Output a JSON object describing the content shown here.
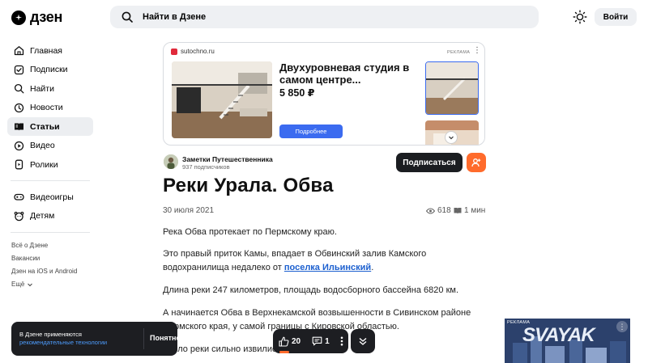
{
  "header": {
    "logo_text": "дзен",
    "search_placeholder": "Найти в Дзене",
    "login_label": "Войти"
  },
  "sidebar": {
    "items": [
      {
        "label": "Главная",
        "icon": "home-icon"
      },
      {
        "label": "Подписки",
        "icon": "subscriptions-icon"
      },
      {
        "label": "Найти",
        "icon": "search-icon"
      },
      {
        "label": "Новости",
        "icon": "news-icon"
      },
      {
        "label": "Статьи",
        "icon": "articles-icon",
        "active": true
      },
      {
        "label": "Видео",
        "icon": "video-icon"
      },
      {
        "label": "Ролики",
        "icon": "clips-icon"
      },
      {
        "label": "Видеоигры",
        "icon": "gamepad-icon"
      },
      {
        "label": "Детям",
        "icon": "kids-icon"
      }
    ],
    "footer_links": [
      "Всё о Дзене",
      "Вакансии",
      "Дзен на iOS и Android",
      "Ещё"
    ]
  },
  "ad": {
    "source": "sutochno.ru",
    "label": "РЕКЛАМА",
    "title": "Двухуровневая студия в самом центре...",
    "price": "5 850 ₽",
    "button": "Подробнее"
  },
  "channel": {
    "name": "Заметки Путешественника",
    "subscribers": "937 подписчиков",
    "subscribe_label": "Подписаться"
  },
  "article": {
    "title": "Реки Урала. Обва",
    "date": "30 июля 2021",
    "views": "618",
    "read_time": "1 мин",
    "p1": "Река Обва протекает по Пермскому краю.",
    "p2_before": "Это правый приток Камы, впадает в Обвинский залив Камского водохранилища недалеко от ",
    "p2_link": "поселка Ильинский",
    "p2_after": ".",
    "p3": "Длина реки 247 километров, площадь водосборного бассейна 6820 км.",
    "p4": "А начинается Обва в Верхнекамской возвышенности в Сивинском районе Пермского края, у самой границы с Кировской областью.",
    "p5": "Русло реки сильно извилистое"
  },
  "toast": {
    "line1": "В Дзене применяются",
    "link": "рекомендательные технологии",
    "button": "Понятно"
  },
  "actions": {
    "likes": "20",
    "comments": "1"
  },
  "side_ad": {
    "label": "РЕКЛАМА",
    "logo": "SVAYAK"
  },
  "colors": {
    "accent_blue": "#3b6bf0",
    "accent_orange": "#ff6b2c",
    "dark": "#1d1e22"
  }
}
